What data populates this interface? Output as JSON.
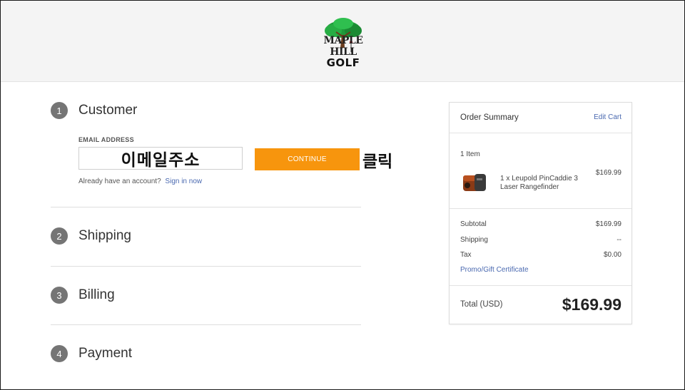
{
  "brand": {
    "name_top": "MAPLE HILL",
    "name_bottom": "GOLF"
  },
  "steps": [
    {
      "number": "1",
      "title": "Customer"
    },
    {
      "number": "2",
      "title": "Shipping"
    },
    {
      "number": "3",
      "title": "Billing"
    },
    {
      "number": "4",
      "title": "Payment"
    }
  ],
  "customer": {
    "email_label": "EMAIL ADDRESS",
    "email_value": "이메일주소",
    "continue_label": "CONTINUE",
    "click_note": "클릭",
    "signin_prompt": "Already have an account?",
    "signin_link": "Sign in now"
  },
  "summary": {
    "title": "Order Summary",
    "edit_cart": "Edit Cart",
    "item_count": "1 Item",
    "product": {
      "name": "1 x Leupold PinCaddie 3 Laser Rangefinder",
      "price": "$169.99"
    },
    "rows": [
      {
        "label": "Subtotal",
        "value": "$169.99"
      },
      {
        "label": "Shipping",
        "value": "--"
      },
      {
        "label": "Tax",
        "value": "$0.00"
      }
    ],
    "promo": "Promo/Gift Certificate",
    "total_label": "Total (USD)",
    "total_value": "$169.99"
  },
  "colors": {
    "accent": "#f7950d",
    "link": "#4a69b0",
    "step_badge": "#757575"
  }
}
